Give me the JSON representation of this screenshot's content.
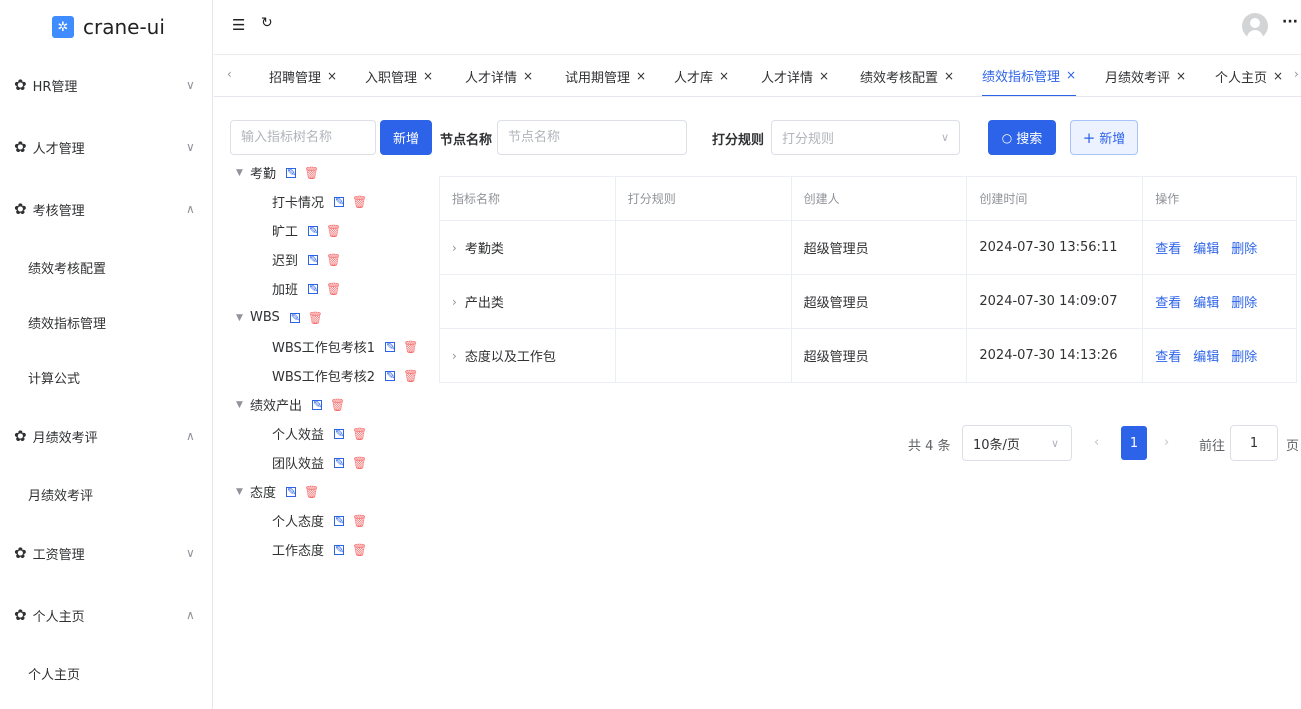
{
  "app": {
    "title": "crane-ui",
    "logo_color": "#3f8cff",
    "accent": "#2d63e8"
  },
  "sidebar": {
    "items": [
      {
        "type": "group",
        "label": "HR管理",
        "expanded": false
      },
      {
        "type": "group",
        "label": "人才管理",
        "expanded": false
      },
      {
        "type": "group",
        "label": "考核管理",
        "expanded": true
      },
      {
        "type": "sub",
        "label": "绩效考核配置"
      },
      {
        "type": "sub",
        "label": "绩效指标管理"
      },
      {
        "type": "sub",
        "label": "计算公式"
      },
      {
        "type": "group",
        "label": "月绩效考评",
        "expanded": true
      },
      {
        "type": "sub",
        "label": "月绩效考评"
      },
      {
        "type": "group",
        "label": "工资管理",
        "expanded": false
      },
      {
        "type": "group",
        "label": "个人主页",
        "expanded": true
      },
      {
        "type": "sub",
        "label": "个人主页"
      }
    ]
  },
  "header": {
    "menu_icon": "menu-toggle-icon",
    "refresh_icon": "refresh-icon",
    "more_label": "···"
  },
  "tabs": [
    {
      "label": "招聘管理",
      "active": false
    },
    {
      "label": "入职管理",
      "active": false
    },
    {
      "label": "人才详情",
      "active": false
    },
    {
      "label": "试用期管理",
      "active": false
    },
    {
      "label": "人才库",
      "active": false
    },
    {
      "label": "人才详情",
      "active": false
    },
    {
      "label": "绩效考核配置",
      "active": false
    },
    {
      "label": "绩效指标管理",
      "active": true
    },
    {
      "label": "月绩效考评",
      "active": false
    },
    {
      "label": "个人主页",
      "active": false
    }
  ],
  "tree_search": {
    "placeholder": "输入指标树名称",
    "add_label": "新增"
  },
  "filters": {
    "node_label": "节点名称",
    "node_placeholder": "节点名称",
    "rule_label": "打分规则",
    "rule_placeholder": "打分规则",
    "search_label": "搜索",
    "add_label": "新增"
  },
  "tree": [
    {
      "label": "考勤",
      "level": 0
    },
    {
      "label": "打卡情况",
      "level": 1
    },
    {
      "label": "旷工",
      "level": 1
    },
    {
      "label": "迟到",
      "level": 1
    },
    {
      "label": "加班",
      "level": 1
    },
    {
      "label": "WBS",
      "level": 0
    },
    {
      "label": "WBS工作包考核1",
      "level": 1
    },
    {
      "label": "WBS工作包考核2",
      "level": 1
    },
    {
      "label": "绩效产出",
      "level": 0
    },
    {
      "label": "个人效益",
      "level": 1
    },
    {
      "label": "团队效益",
      "level": 1
    },
    {
      "label": "态度",
      "level": 0
    },
    {
      "label": "个人态度",
      "level": 1
    },
    {
      "label": "工作态度",
      "level": 1
    }
  ],
  "table": {
    "columns": [
      "指标名称",
      "打分规则",
      "创建人",
      "创建时间",
      "操作"
    ],
    "rows": [
      {
        "name": "考勤类",
        "rule": "",
        "creator": "超级管理员",
        "time": "2024-07-30 13:56:11"
      },
      {
        "name": "产出类",
        "rule": "",
        "creator": "超级管理员",
        "time": "2024-07-30 14:09:07"
      },
      {
        "name": "态度以及工作包",
        "rule": "",
        "creator": "超级管理员",
        "time": "2024-07-30 14:13:26"
      }
    ],
    "actions": [
      "查看",
      "编辑",
      "删除"
    ]
  },
  "pagination": {
    "total": "共 4 条",
    "page_size": "10条/页",
    "current": "1",
    "goto_label": "前往",
    "goto_value": "1",
    "page_suffix": "页"
  }
}
